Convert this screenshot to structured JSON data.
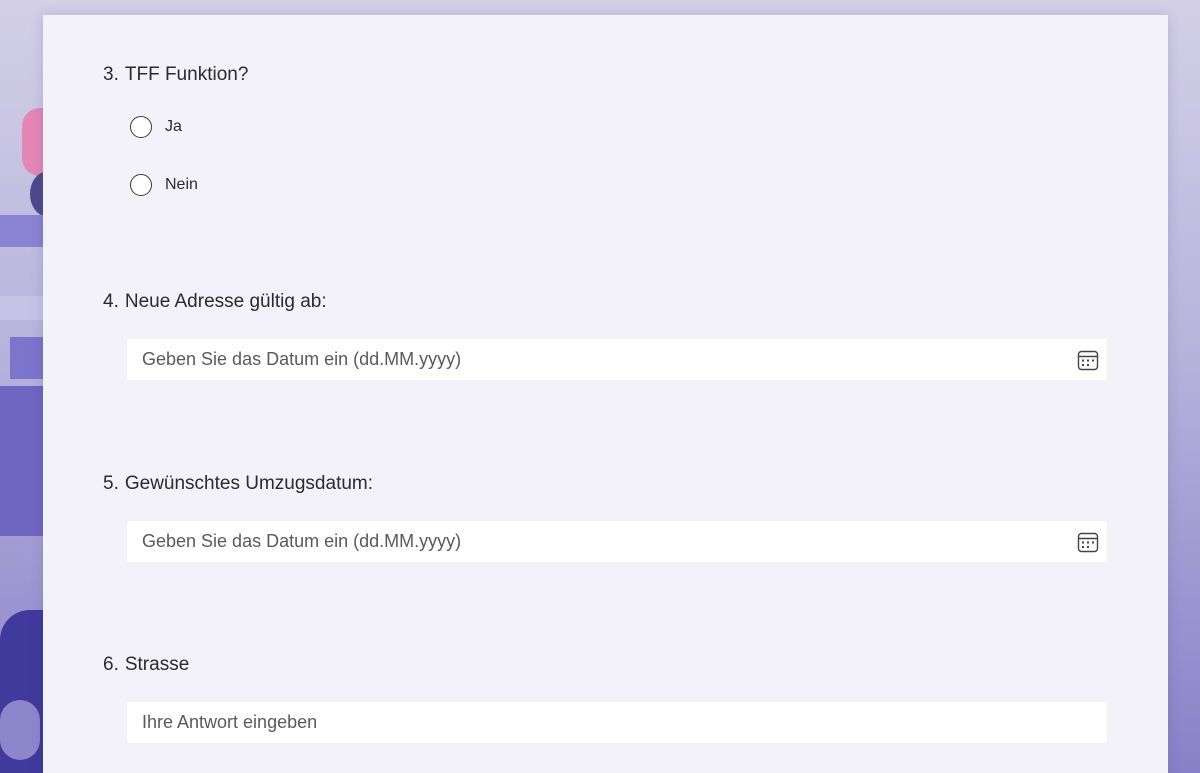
{
  "questions": [
    {
      "number": "3.",
      "title": "TFF Funktion?",
      "type": "radio",
      "options": [
        "Ja",
        "Nein"
      ]
    },
    {
      "number": "4.",
      "title": "Neue Adresse gültig ab:",
      "type": "date",
      "placeholder": "Geben Sie das Datum ein (dd.MM.yyyy)",
      "icon": "calendar-icon"
    },
    {
      "number": "5.",
      "title": "Gewünschtes Umzugsdatum:",
      "type": "date",
      "placeholder": "Geben Sie das Datum ein (dd.MM.yyyy)",
      "icon": "calendar-icon"
    },
    {
      "number": "6.",
      "title": "Strasse",
      "type": "text",
      "placeholder": "Ihre Antwort eingeben"
    }
  ]
}
